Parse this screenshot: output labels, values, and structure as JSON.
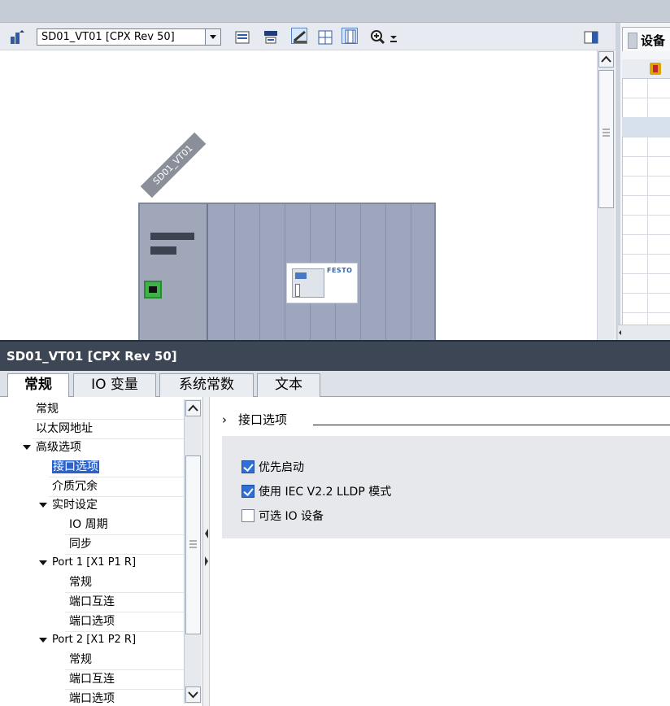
{
  "toolbar": {
    "device_select_value": "SD01_VT01 [CPX Rev 50]"
  },
  "canvas": {
    "device_name_tag": "SD01_VT01",
    "device_logo_text": "FESTO"
  },
  "right_panel": {
    "tab_label": "设备"
  },
  "inspector": {
    "title": "SD01_VT01 [CPX Rev 50]",
    "tabs": [
      {
        "label": "常规"
      },
      {
        "label": "IO 变量"
      },
      {
        "label": "系统常数"
      },
      {
        "label": "文本"
      }
    ],
    "nav": {
      "items": [
        {
          "label": "常规"
        },
        {
          "label": "以太网地址"
        },
        {
          "label": "高级选项"
        },
        {
          "label": "接口选项"
        },
        {
          "label": "介质冗余"
        },
        {
          "label": "实时设定"
        },
        {
          "label": "IO 周期"
        },
        {
          "label": "同步"
        },
        {
          "label": "Port 1 [X1 P1 R]"
        },
        {
          "label": "常规"
        },
        {
          "label": "端口互连"
        },
        {
          "label": "端口选项"
        },
        {
          "label": "Port 2 [X1 P2 R]"
        },
        {
          "label": "常规"
        },
        {
          "label": "端口互连"
        },
        {
          "label": "端口选项"
        }
      ]
    },
    "content": {
      "section_arrow": "›",
      "section_title": "接口选项",
      "options": [
        {
          "label": "优先启动",
          "checked": true
        },
        {
          "label": "使用 IEC V2.2 LLDP 模式",
          "checked": true
        },
        {
          "label": "可选 IO 设备",
          "checked": false
        }
      ]
    }
  },
  "colors": {
    "inspector_title_bg": "#3d4654",
    "selection": "#2a62c9",
    "device_body": "#9ea6be",
    "checkbox_on": "#2f6fd6"
  }
}
